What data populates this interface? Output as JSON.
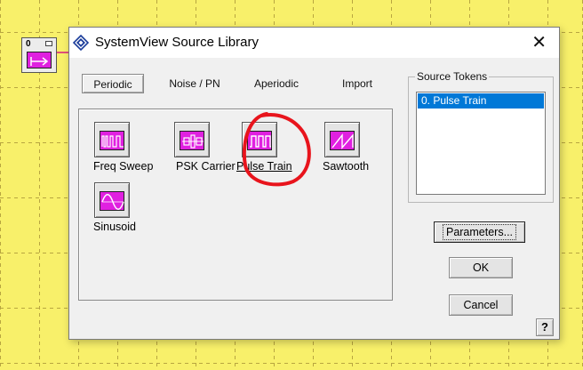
{
  "canvas": {
    "background": "#f8f06a",
    "grid_color": "#b8a640"
  },
  "token": {
    "number": "0"
  },
  "dialog": {
    "title": "SystemView Source Library",
    "close_label": "✕",
    "tabs": [
      {
        "label": "Periodic",
        "active": true
      },
      {
        "label": "Noise / PN",
        "active": false
      },
      {
        "label": "Aperiodic",
        "active": false
      },
      {
        "label": "Import",
        "active": false
      }
    ],
    "sources": [
      {
        "label": "Freq Sweep",
        "icon": "freq-sweep-icon"
      },
      {
        "label": "PSK Carrier",
        "icon": "psk-carrier-icon"
      },
      {
        "label": "Pulse Train",
        "icon": "pulse-train-icon",
        "selected": true
      },
      {
        "label": "Sawtooth",
        "icon": "sawtooth-icon"
      },
      {
        "label": "Sinusoid",
        "icon": "sinusoid-icon"
      }
    ],
    "source_tokens": {
      "title": "Source Tokens",
      "items": [
        "0. Pulse Train"
      ]
    },
    "buttons": {
      "parameters": "Parameters...",
      "ok": "OK",
      "cancel": "Cancel",
      "help": "?"
    },
    "accent": "#0078d7",
    "icon_color": "#e020e0",
    "annotation_color": "#e8141c"
  }
}
